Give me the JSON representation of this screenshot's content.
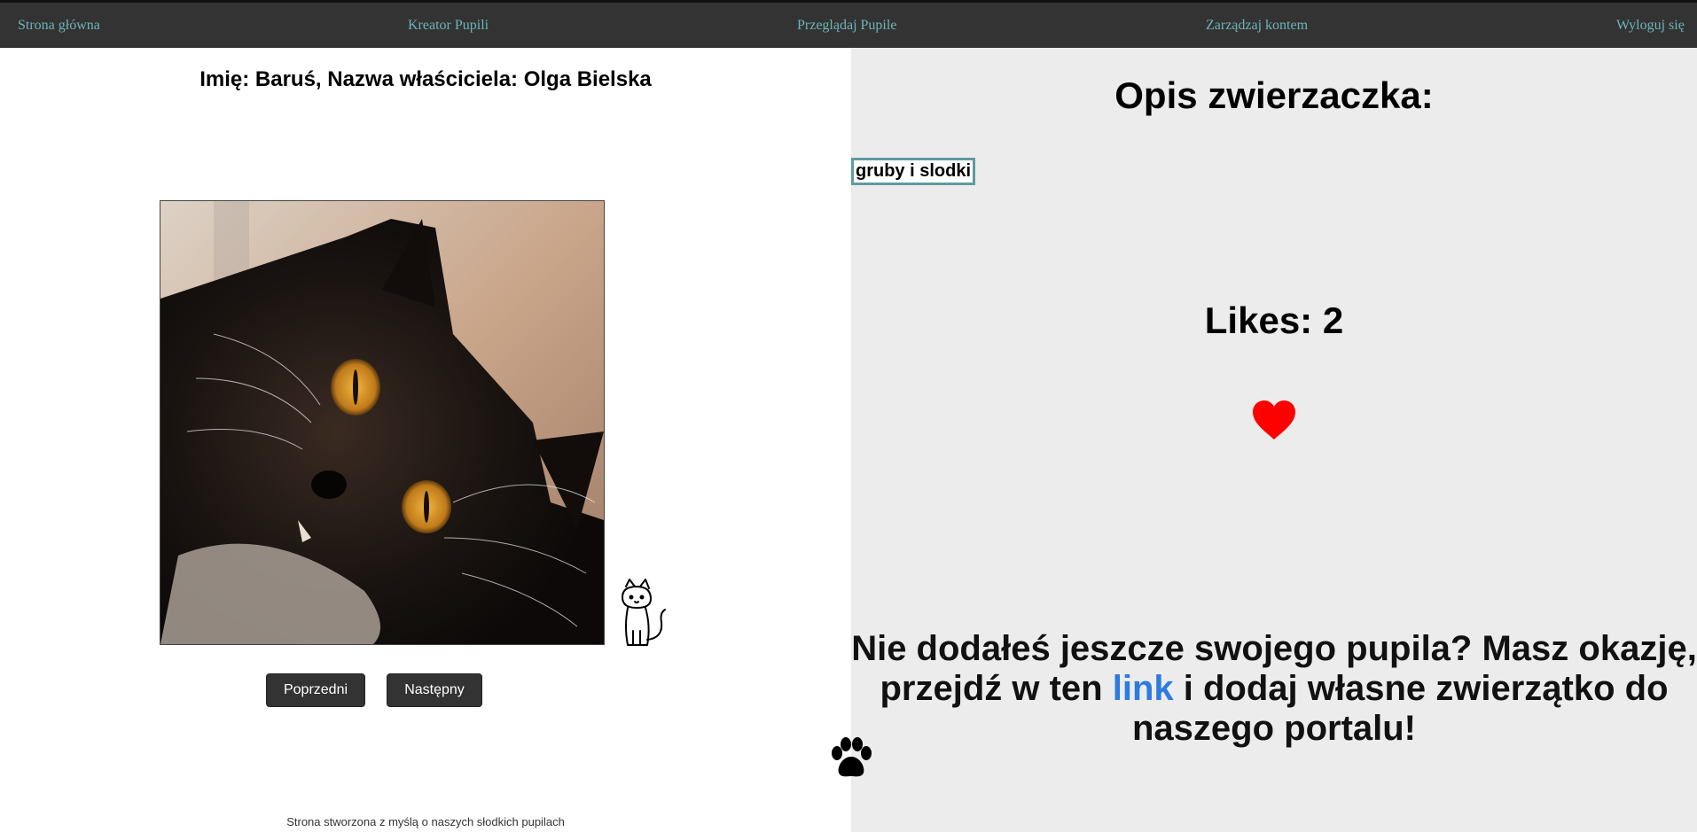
{
  "nav": {
    "home": "Strona główna",
    "creator": "Kreator Pupili",
    "browse": "Przeglądaj Pupile",
    "account": "Zarządzaj kontem",
    "logout": "Wyloguj się"
  },
  "pet": {
    "header": "Imię: Baruś, Nazwa właściciela: Olga Bielska",
    "photo_icon": "black-cat-photo"
  },
  "buttons": {
    "prev": "Poprzedni",
    "next": "Następny"
  },
  "footer": {
    "text": "Strona stworzona z myślą o naszych słodkich pupilach",
    "paw_icon": "paw-icon"
  },
  "description": {
    "title": "Opis zwierzaczka:",
    "value": "gruby i slodki"
  },
  "likes": {
    "text": "Likes: 2",
    "heart_icon": "heart-icon",
    "heart_color": "#ff0000"
  },
  "cta": {
    "text_before": "Nie dodałeś jeszcze swojego pupila? Masz okazję, przejdź w ten ",
    "link_text": "link",
    "text_after": " i dodaj własne zwierzątko do naszego portalu!",
    "link_color": "#2e7be0"
  },
  "colors": {
    "nav_bg": "#333333",
    "nav_link": "#6fb3b8",
    "right_panel_bg": "#ececec"
  }
}
